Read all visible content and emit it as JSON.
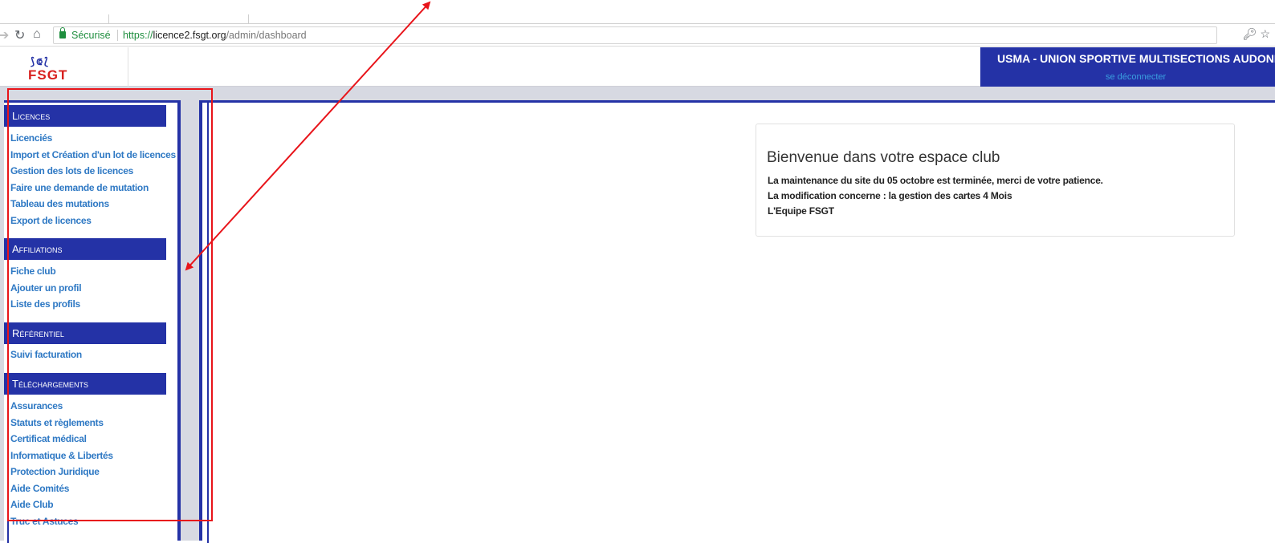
{
  "browser": {
    "back_icon": "arrow-right-icon",
    "reload_icon": "reload-icon",
    "home_icon": "home-icon",
    "secure_label": "Sécurisé",
    "url_scheme": "https://",
    "url_host": "licence2.fsgt.org",
    "url_path": "/admin/dashboard",
    "key_icon": "key-icon",
    "star_icon": "star-icon"
  },
  "header": {
    "logo_text": "FSGT",
    "club_name": "USMA - UNION SPORTIVE MULTISECTIONS AUDONIENN",
    "logout_label": "se déconnecter"
  },
  "sidebar": {
    "sections": [
      {
        "title": "Licences",
        "links": [
          "Licenciés",
          "Import et Création d'un lot de licences",
          "Gestion des lots de licences",
          "Faire une demande de mutation",
          "Tableau des mutations",
          "Export de licences"
        ]
      },
      {
        "title": "Affiliations",
        "links": [
          "Fiche club",
          "Ajouter un profil",
          "Liste des profils"
        ]
      },
      {
        "title": "Référentiel",
        "links": [
          "Suivi facturation"
        ]
      },
      {
        "title": "Téléchargements",
        "links": [
          "Assurances",
          "Statuts et règlements",
          "Certificat médical",
          "Informatique & Libertés",
          "Protection Juridique",
          "Aide Comités",
          "Aide Club",
          "Truc et Astuces"
        ]
      }
    ]
  },
  "welcome": {
    "title": "Bienvenue dans votre espace club",
    "lines": [
      "La maintenance du site du 05 octobre est terminée, merci de votre patience.",
      "La modification concerne : la gestion des cartes 4 Mois",
      "L'Equipe FSGT"
    ]
  },
  "colors": {
    "brand_blue": "#2432a6",
    "link_blue": "#2f79c4",
    "annotation_red": "#e8141a",
    "logo_red": "#d8201e"
  }
}
